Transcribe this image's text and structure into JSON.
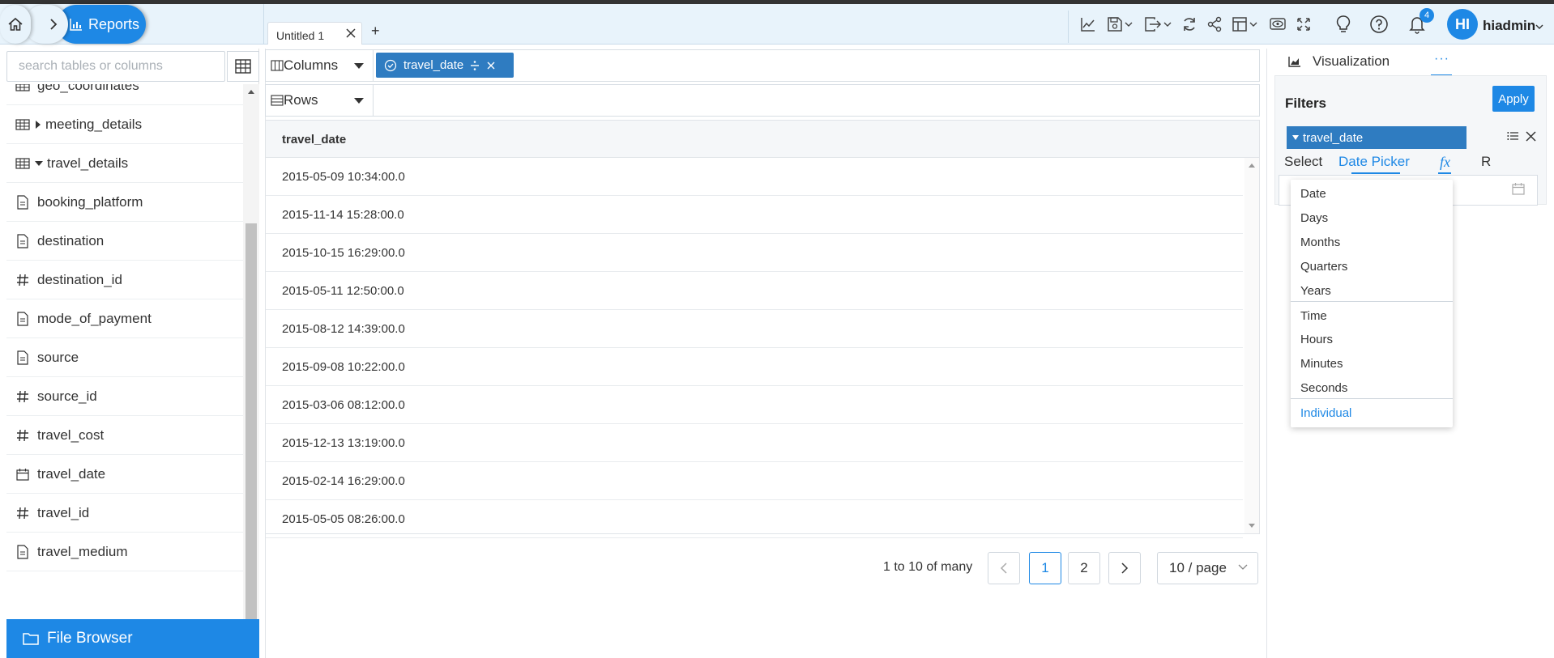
{
  "header": {
    "nav_label": "Reports",
    "tab_title": "Untitled 1",
    "tab_add": "+",
    "notification_count": "4",
    "avatar_initials": "HI",
    "username": "hiadmin"
  },
  "sidebar": {
    "search_placeholder": "search tables or columns",
    "partial_top_item": "geo_coordinates",
    "items": [
      {
        "label": "meeting_details",
        "icon": "table-icon",
        "expand": "collapsed"
      },
      {
        "label": "travel_details",
        "icon": "table-icon",
        "expand": "expanded"
      },
      {
        "label": "booking_platform",
        "icon": "text-column-icon"
      },
      {
        "label": "destination",
        "icon": "text-column-icon"
      },
      {
        "label": "destination_id",
        "icon": "number-column-icon"
      },
      {
        "label": "mode_of_payment",
        "icon": "text-column-icon"
      },
      {
        "label": "source",
        "icon": "text-column-icon"
      },
      {
        "label": "source_id",
        "icon": "number-column-icon"
      },
      {
        "label": "travel_cost",
        "icon": "number-column-icon"
      },
      {
        "label": "travel_date",
        "icon": "date-column-icon"
      },
      {
        "label": "travel_id",
        "icon": "number-column-icon"
      },
      {
        "label": "travel_medium",
        "icon": "text-column-icon"
      }
    ],
    "file_browser_label": "File Browser"
  },
  "shelves": {
    "columns_label": "Columns",
    "rows_label": "Rows",
    "column_pill": "travel_date"
  },
  "grid": {
    "header": "travel_date",
    "rows": [
      "2015-05-09 10:34:00.0",
      "2015-11-14 15:28:00.0",
      "2015-10-15 16:29:00.0",
      "2015-05-11 12:50:00.0",
      "2015-08-12 14:39:00.0",
      "2015-09-08 10:22:00.0",
      "2015-03-06 08:12:00.0",
      "2015-12-13 13:19:00.0",
      "2015-02-14 16:29:00.0",
      "2015-05-05 08:26:00.0"
    ]
  },
  "pagination": {
    "info": "1 to 10 of many",
    "prev": "<",
    "pages": [
      "1",
      "2"
    ],
    "current_page": "1",
    "next": ">",
    "page_size": "10 / page"
  },
  "right_panel": {
    "visualization_tab": "Visualization",
    "more_tab": "···",
    "filters_title": "Filters",
    "apply_label": "Apply",
    "filter_field": "travel_date",
    "filter_tabs": {
      "select": "Select",
      "date_picker": "Date Picker",
      "fx": "fx",
      "r": "R"
    },
    "dropdown_options": [
      "Date",
      "Days",
      "Months",
      "Quarters",
      "Years",
      "Time",
      "Hours",
      "Minutes",
      "Seconds",
      "Individual"
    ]
  },
  "colors": {
    "accent": "#1e88e5",
    "pill": "#2f7cc1",
    "header_bg": "#e8f3fb"
  }
}
